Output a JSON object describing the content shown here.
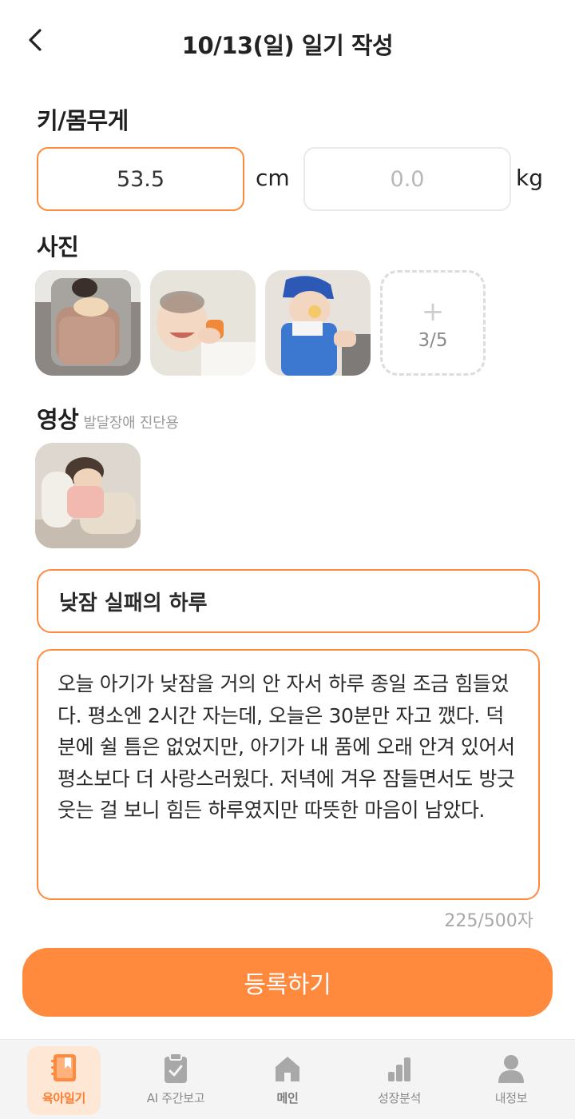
{
  "header": {
    "title": "10/13(일) 일기 작성"
  },
  "measure": {
    "label": "키/몸무게",
    "height_value": "53.5",
    "height_unit": "cm",
    "weight_placeholder": "0.0",
    "weight_unit": "kg"
  },
  "photos": {
    "label": "사진",
    "add_count": "3/5"
  },
  "video": {
    "label": "영상",
    "sublabel": "발달장애 진단용"
  },
  "diary": {
    "title": "낮잠 실패의 하루",
    "body": "오늘 아기가 낮잠을 거의 안 자서 하루 종일 조금 힘들었다. 평소엔 2시간 자는데, 오늘은 30분만 자고 깼다. 덕분에 쉴 틈은 없었지만, 아기가 내 품에 오래 안겨 있어서 평소보다 더 사랑스러웠다. 저녁에 겨우 잠들면서도 방긋 웃는 걸 보니 힘든 하루였지만 따뜻한 마음이 남았다.",
    "char_count": "225/500자"
  },
  "submit_label": "등록하기",
  "tabbar": {
    "items": [
      {
        "label": "육아일기",
        "icon": "diary-icon",
        "active": true
      },
      {
        "label": "AI 주간보고",
        "icon": "clipboard-icon",
        "active": false
      },
      {
        "label": "메인",
        "icon": "home-icon",
        "active": false
      },
      {
        "label": "성장분석",
        "icon": "bar-chart-icon",
        "active": false
      },
      {
        "label": "내정보",
        "icon": "person-icon",
        "active": false
      }
    ]
  },
  "colors": {
    "accent": "#ff8a3d",
    "tab_active_bg": "#ffe7d6"
  }
}
